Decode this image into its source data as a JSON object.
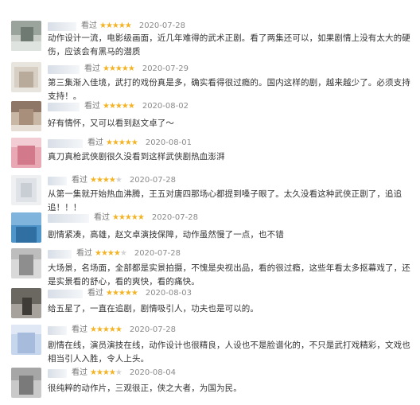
{
  "reviews": [
    {
      "seen_label": "看过",
      "stars": 5,
      "star_text": "★★★★★",
      "date": "2020-07-28",
      "text": "动作设计一流，电影级画面，近几年难得的武术正剧。看了两集还可以，如果剧情上没有太大的硬伤，应该会有黑马的潜质"
    },
    {
      "seen_label": "看过",
      "stars": 5,
      "star_text": "★★★★★",
      "date": "2020-07-29",
      "text": "第三集渐入佳境，武打的戏份真是多，确实看得很过瘾的。国内这样的剧，越来越少了。必须支持支持！。"
    },
    {
      "seen_label": "看过",
      "stars": 5,
      "star_text": "★★★★★",
      "date": "2020-08-02",
      "text": "好有情怀，又可以看到赵文卓了～"
    },
    {
      "seen_label": "看过",
      "stars": 5,
      "star_text": "★★★★★",
      "date": "2020-08-01",
      "text": "真刀真枪武侠剧很久没看到这样武侠剧热血澎湃"
    },
    {
      "seen_label": "看过",
      "stars": 4,
      "star_text": "★★★★★",
      "date": "2020-07-28",
      "text": "从第一集就开始热血沸腾，王五对唐四那场心都提到嗓子眼了。太久没看这种武侠正剧了，追追追！！！"
    },
    {
      "seen_label": "看过",
      "stars": 5,
      "star_text": "★★★★★",
      "date": "2020-07-28",
      "text": "剧情紧凑，高雄，赵文卓演技保障，动作虽然慢了一点，也不错"
    },
    {
      "seen_label": "看过",
      "stars": 4,
      "star_text": "★★★★★",
      "date": "2020-07-28",
      "text": "大场景，名场面，全部都是实景拍摄，不愧是央视出品，看的很过瘾，这些年看太多抠幕戏了，还是实景看的舒心，看的爽快，看的痛快。"
    },
    {
      "seen_label": "看过",
      "stars": 5,
      "star_text": "★★★★★",
      "date": "2020-08-03",
      "text": "给五星了，一直在追剧，剧情吸引人，功夫也是可以的。"
    },
    {
      "seen_label": "看过",
      "stars": 5,
      "star_text": "★★★★★",
      "date": "2020-07-28",
      "text": "剧情在线，演员演技在线，动作设计也很精良，人设也不是脸谱化的，不只是武打戏精彩，文戏也相当引人入胜，令人上头。"
    },
    {
      "seen_label": "看过",
      "stars": 4,
      "star_text": "★★★★★",
      "date": "2020-08-04",
      "text": "很纯粹的动作片，三观很正，侠之大者，为国为民。"
    }
  ],
  "colors": {
    "star": "#f4b322",
    "star_off": "#d3d3d3",
    "date": "#8a8a8a"
  }
}
